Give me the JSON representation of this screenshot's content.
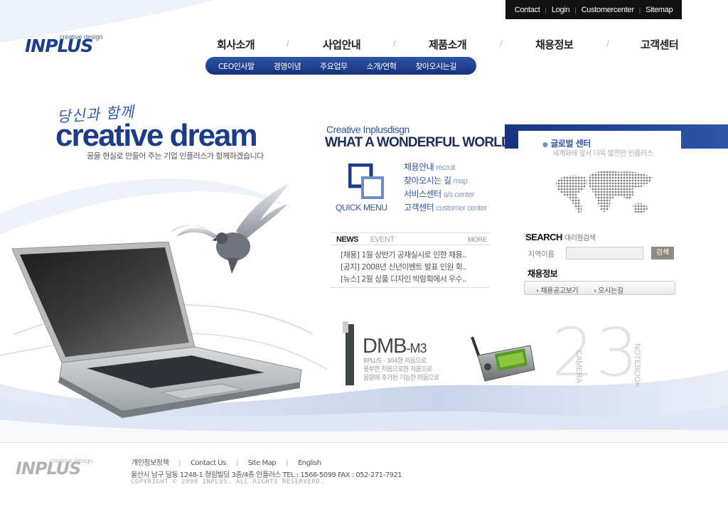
{
  "utility_nav": [
    "Contact",
    "Login",
    "Customercenter",
    "Sitemap"
  ],
  "logo": {
    "main": "INPLUS",
    "sub": "creative design"
  },
  "main_nav": [
    "회사소개",
    "사업안내",
    "제품소개",
    "채용정보",
    "고객센터"
  ],
  "sub_nav": [
    "CEO인사말",
    "경영이념",
    "주요업무",
    "소개/연혁",
    "찾아오시는길"
  ],
  "hero": {
    "script": "당신과 함께",
    "title": "creative dream",
    "subtitle": "꿈을 현실로 만들어 주는 기업 인플러스가 함께하겠습니다"
  },
  "wonder": {
    "small": "Creative Inplusdisgn",
    "big": "WHAT A WONDERFUL WORLD"
  },
  "quick_menu": {
    "label": "QUICK MENU",
    "items": [
      {
        "ko": "채용안내",
        "en": "recruit"
      },
      {
        "ko": "찾아오시는 길",
        "en": "map"
      },
      {
        "ko": "서비스센터",
        "en": "a/s center"
      },
      {
        "ko": "고객센터",
        "en": "customer center"
      }
    ]
  },
  "news": {
    "tab_news": "NEWS",
    "tab_event": "EVENT",
    "more": "MORE",
    "items": [
      "[채용] 1월 상반기 공채실시로 인한 채용..",
      "[공지] 2008년 신년이벤트 발표 인원 회..",
      "[뉴스] 2월 상품 디자인 박람회에서 우수.."
    ]
  },
  "global_center": {
    "title": "글로벌 센터",
    "desc": "세계화에 앞서 더욱 발전한 인플러스"
  },
  "search": {
    "title": "SEARCH",
    "title_small": "대리점검색",
    "field_label": "지역이름",
    "button": "검색",
    "value": ""
  },
  "recruit": {
    "title": "채용정보",
    "link1": "› 채용공고보기",
    "link2": "› 오시는길"
  },
  "products": {
    "num2": "2",
    "num3": "3",
    "dmb_name": "DMB",
    "dmb_model": "-M3",
    "dmb_desc": [
      "BPLUS - 304한 저음으로",
      "풍부한 저음으로한 저음으로",
      "음향에 추가된 기능한 저음으로"
    ],
    "camera": "CAMERA",
    "notebook": "NOTEBOOK"
  },
  "footer": {
    "links": [
      "개인정보정책",
      "Contact Us",
      "Site Map",
      "English"
    ],
    "address": "울산시 남구 달동 1248-1 청림빌딩 3층/4층 인플러스 TEL : 1566-5099   FAX : 052-271-7921",
    "copyright": "COPYRIGHT © 2008 INPLUS. ALL RIGHTS RESERVERD.",
    "logo_main": "INPLUS",
    "logo_sub": "creative design"
  },
  "colors": {
    "brand_blue": "#1d3c85",
    "accent_blue": "#2e56a4",
    "util_bar": "#111111"
  }
}
